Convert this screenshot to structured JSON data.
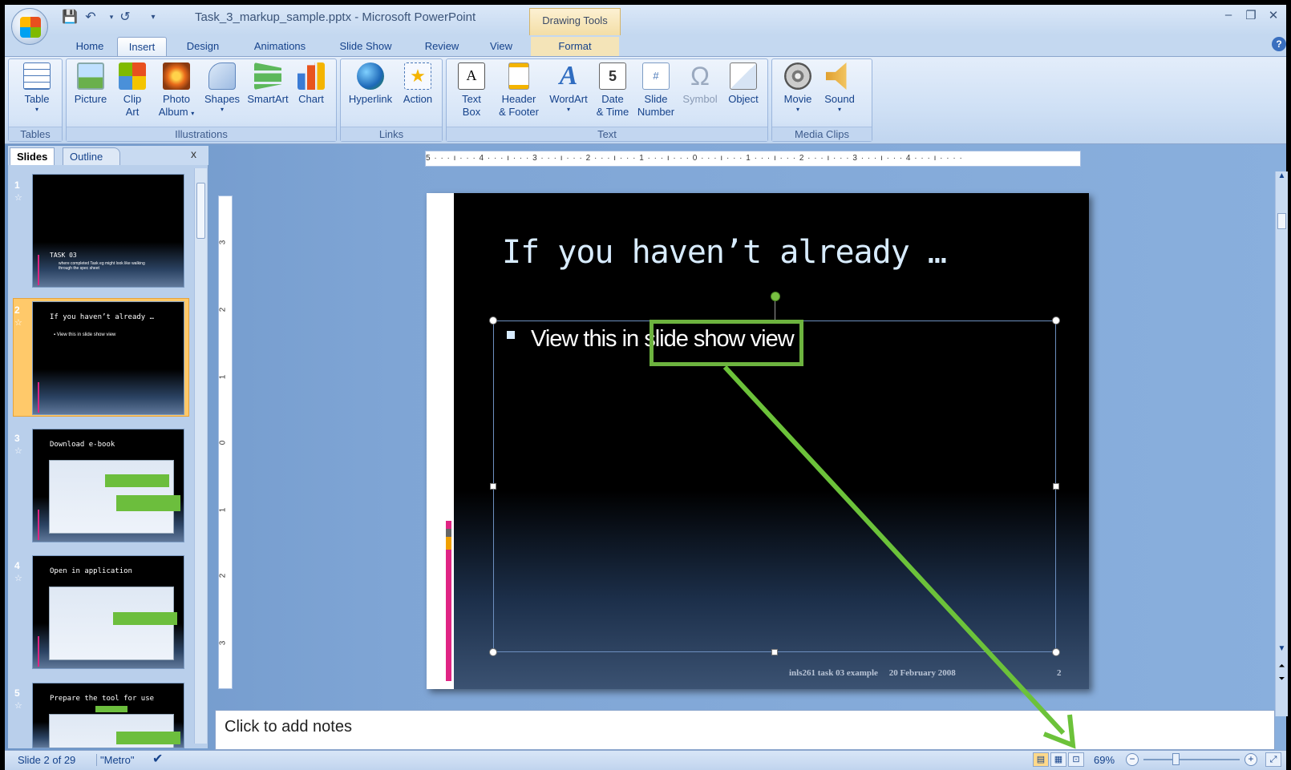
{
  "window": {
    "title": "Task_3_markup_sample.pptx - Microsoft PowerPoint",
    "contextual_tab_group": "Drawing Tools",
    "controls": [
      "minimize-icon",
      "restore-icon",
      "close-icon"
    ]
  },
  "quick_access": [
    "save-icon",
    "undo-icon",
    "redo-icon",
    "customize-icon"
  ],
  "tabs": [
    {
      "label": "Home"
    },
    {
      "label": "Insert",
      "active": true
    },
    {
      "label": "Design"
    },
    {
      "label": "Animations"
    },
    {
      "label": "Slide Show"
    },
    {
      "label": "Review"
    },
    {
      "label": "View"
    },
    {
      "label": "Format"
    }
  ],
  "ribbon": {
    "groups": {
      "tables": "Tables",
      "illustrations": "Illustrations",
      "links": "Links",
      "text": "Text",
      "media": "Media Clips"
    },
    "buttons": {
      "table": "Table",
      "picture": "Picture",
      "clip_art_1": "Clip",
      "clip_art_2": "Art",
      "photo_album_1": "Photo",
      "photo_album_2": "Album",
      "shapes": "Shapes",
      "smartart": "SmartArt",
      "chart": "Chart",
      "hyperlink": "Hyperlink",
      "action": "Action",
      "text_box_1": "Text",
      "text_box_2": "Box",
      "header_footer_1": "Header",
      "header_footer_2": "& Footer",
      "wordart": "WordArt",
      "date_time_1": "Date",
      "date_time_2": "& Time",
      "slide_number_1": "Slide",
      "slide_number_2": "Number",
      "symbol": "Symbol",
      "object": "Object",
      "movie": "Movie",
      "sound": "Sound"
    }
  },
  "panes": {
    "slides_tab": "Slides",
    "outline_tab": "Outline",
    "close": "x"
  },
  "thumbnails": [
    {
      "num": "1",
      "title": "TASK 03",
      "body": "where completed Task eg might look like walking through the spec sheet"
    },
    {
      "num": "2",
      "title": "If you haven’t already …",
      "body": "▪ View this in slide show view"
    },
    {
      "num": "3",
      "title": "Download e-book"
    },
    {
      "num": "4",
      "title": "Open in application"
    },
    {
      "num": "5",
      "title": "Prepare the tool for use"
    }
  ],
  "ruler": {
    "horizontal": "5 · · · ı · · · 4 · · · ı · · · 3 · · · ı · · · 2 · · · ı · · · 1 · · · ı · · · 0 · · · ı · · · 1 · · · ı · · · 2 · · · ı · · · 3 · · · ı · · · 4 · · · ı · · · ·",
    "vertical": [
      "3",
      "2",
      "1",
      "0",
      "1",
      "2",
      "3"
    ]
  },
  "slide": {
    "title": "If you haven’t already …",
    "bullet": "View this in slide show view",
    "footer": "inls261 task 03 example",
    "date": "20 February 2008",
    "number": "2"
  },
  "notes": {
    "placeholder": "Click to add notes"
  },
  "status": {
    "slide_info": "Slide 2 of 29",
    "theme": "\"Metro\"",
    "zoom": "69%"
  },
  "colors": {
    "callout": "#6db33f",
    "ribbon": "#cfe0f5",
    "accent_bar": "#e02484"
  }
}
